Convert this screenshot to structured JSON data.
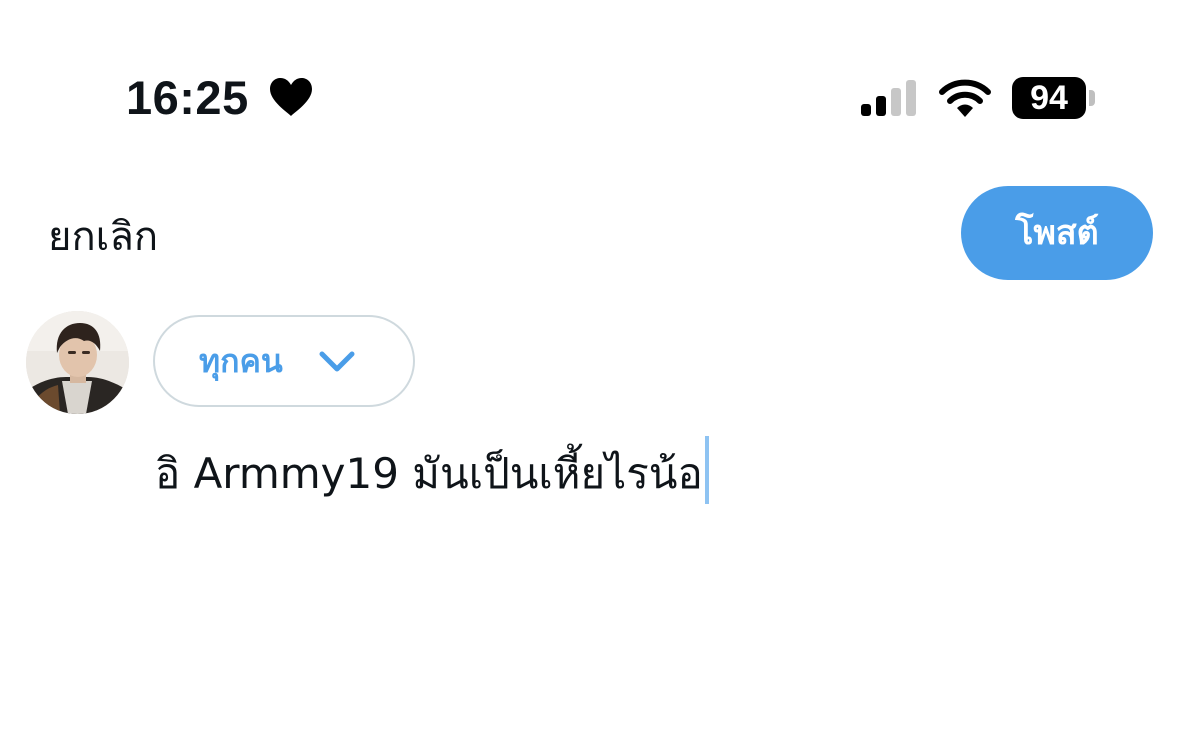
{
  "status_bar": {
    "time": "16:25",
    "heart_icon": "heart-icon",
    "signal_icon": "cellular-signal-icon",
    "wifi_icon": "wifi-icon",
    "battery_percent": "94"
  },
  "header": {
    "cancel_label": "ยกเลิก",
    "post_label": "โพสต์"
  },
  "composer": {
    "audience_label": "ทุกคน",
    "audience_icon": "chevron-down-icon",
    "text": "อิ Armmy19 มันเป็นเหี้ยไรน้อ"
  },
  "colors": {
    "accent": "#4a9de8",
    "text": "#0f1419",
    "pill_border": "#cfd9de",
    "caret": "#8ec3f2"
  }
}
